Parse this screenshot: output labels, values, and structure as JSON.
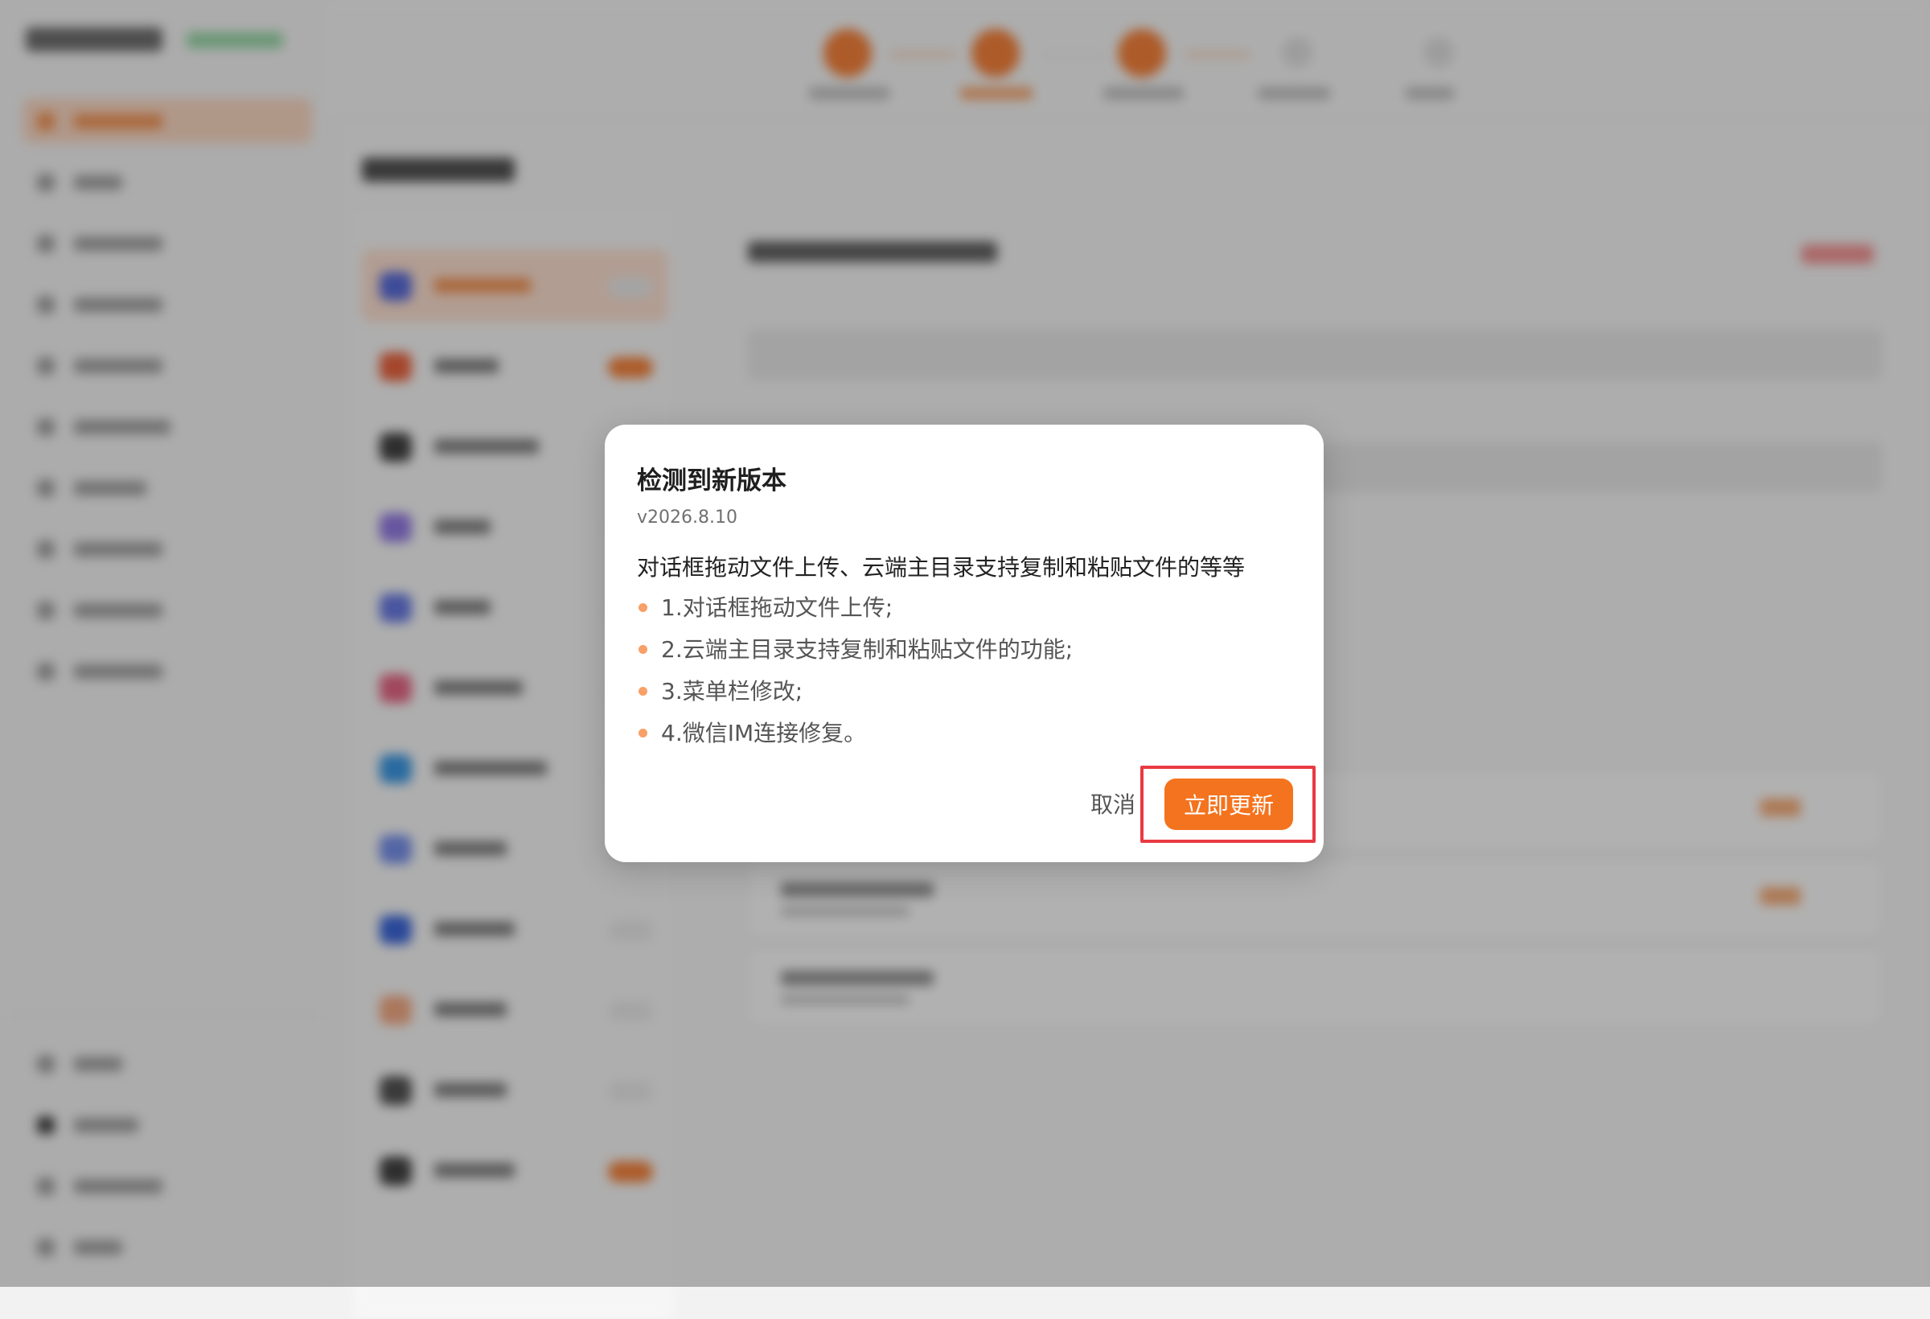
{
  "dialog": {
    "title": "检测到新版本",
    "version": "v2026.8.10",
    "description": "对话框拖动文件上传、云端主目录支持复制和粘贴文件的等等",
    "changes": [
      "1.对话框拖动文件上传;",
      "2.云端主目录支持复制和粘贴文件的功能;",
      "3.菜单栏修改;",
      "4.微信IM连接修复。"
    ],
    "cancel_label": "取消",
    "update_label": "立即更新"
  },
  "colors": {
    "accent": "#f4731e",
    "highlight_border": "#e83a42",
    "bullet": "#f8a068"
  }
}
